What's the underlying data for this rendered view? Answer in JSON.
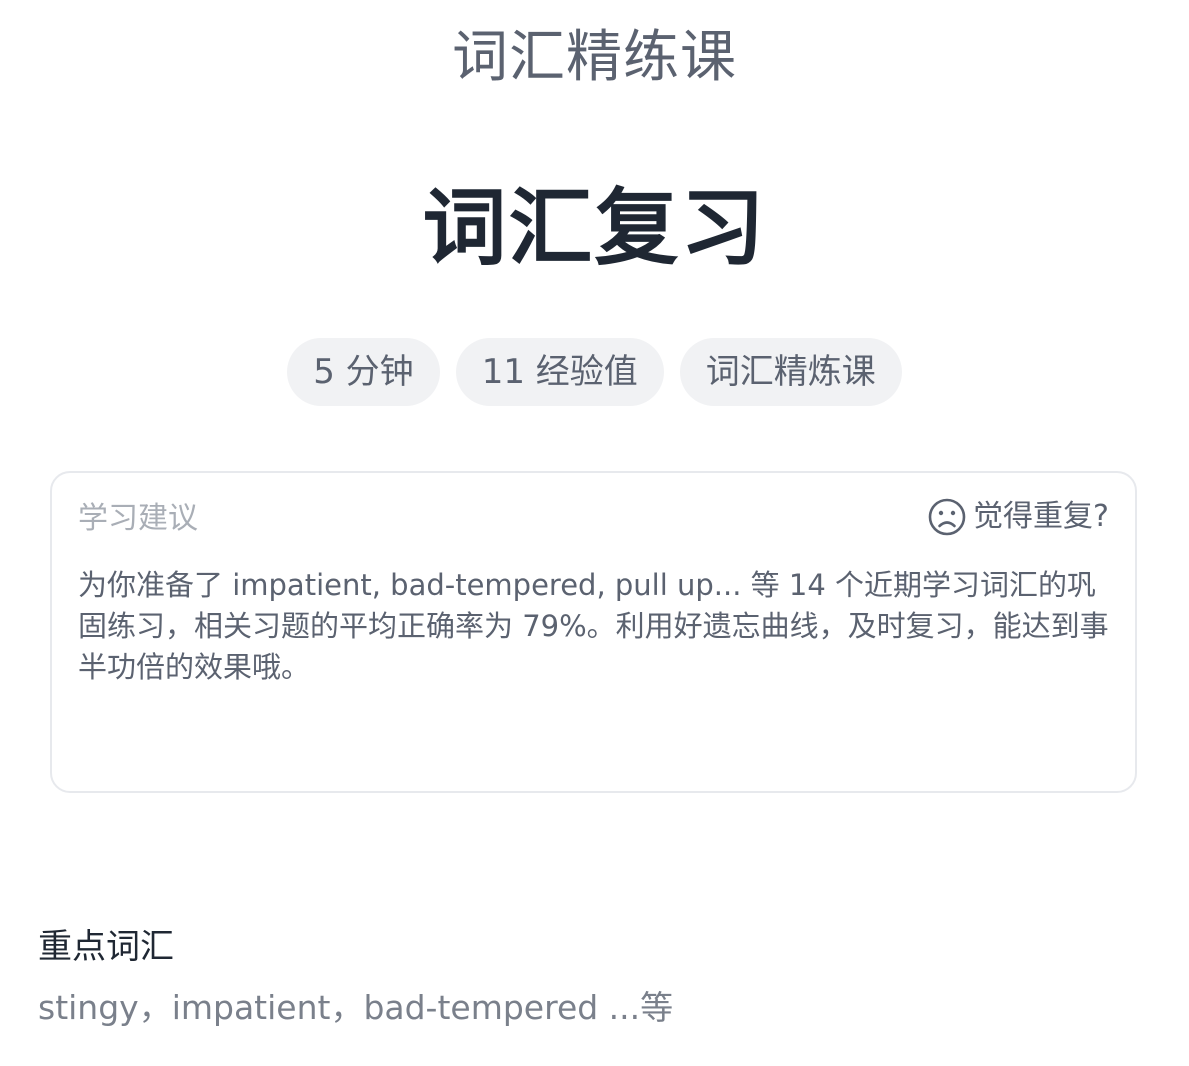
{
  "header": {
    "course_name": "词汇精练课",
    "lesson_title": "词汇复习"
  },
  "tags": [
    {
      "label": "5 分钟"
    },
    {
      "label": "11 经验值"
    },
    {
      "label": "词汇精炼课"
    }
  ],
  "advice": {
    "title": "学习建议",
    "repeat_label": "觉得重复?",
    "repeat_icon": "sad-face-icon",
    "body": "为你准备了 impatient, bad-tempered, pull up... 等 14 个近期学习词汇的巩固练习，相关习题的平均正确率为 79%。利用好遗忘曲线，及时复习，能达到事半功倍的效果哦。"
  },
  "keywords": {
    "title": "重点词汇",
    "list": "stingy，impatient，bad-tempered ...等"
  },
  "colors": {
    "title": "#1f2733",
    "secondary": "#5b6270",
    "muted": "#a9aeb6",
    "tag_bg": "#f1f2f4",
    "card_border": "#e7e9ed"
  }
}
